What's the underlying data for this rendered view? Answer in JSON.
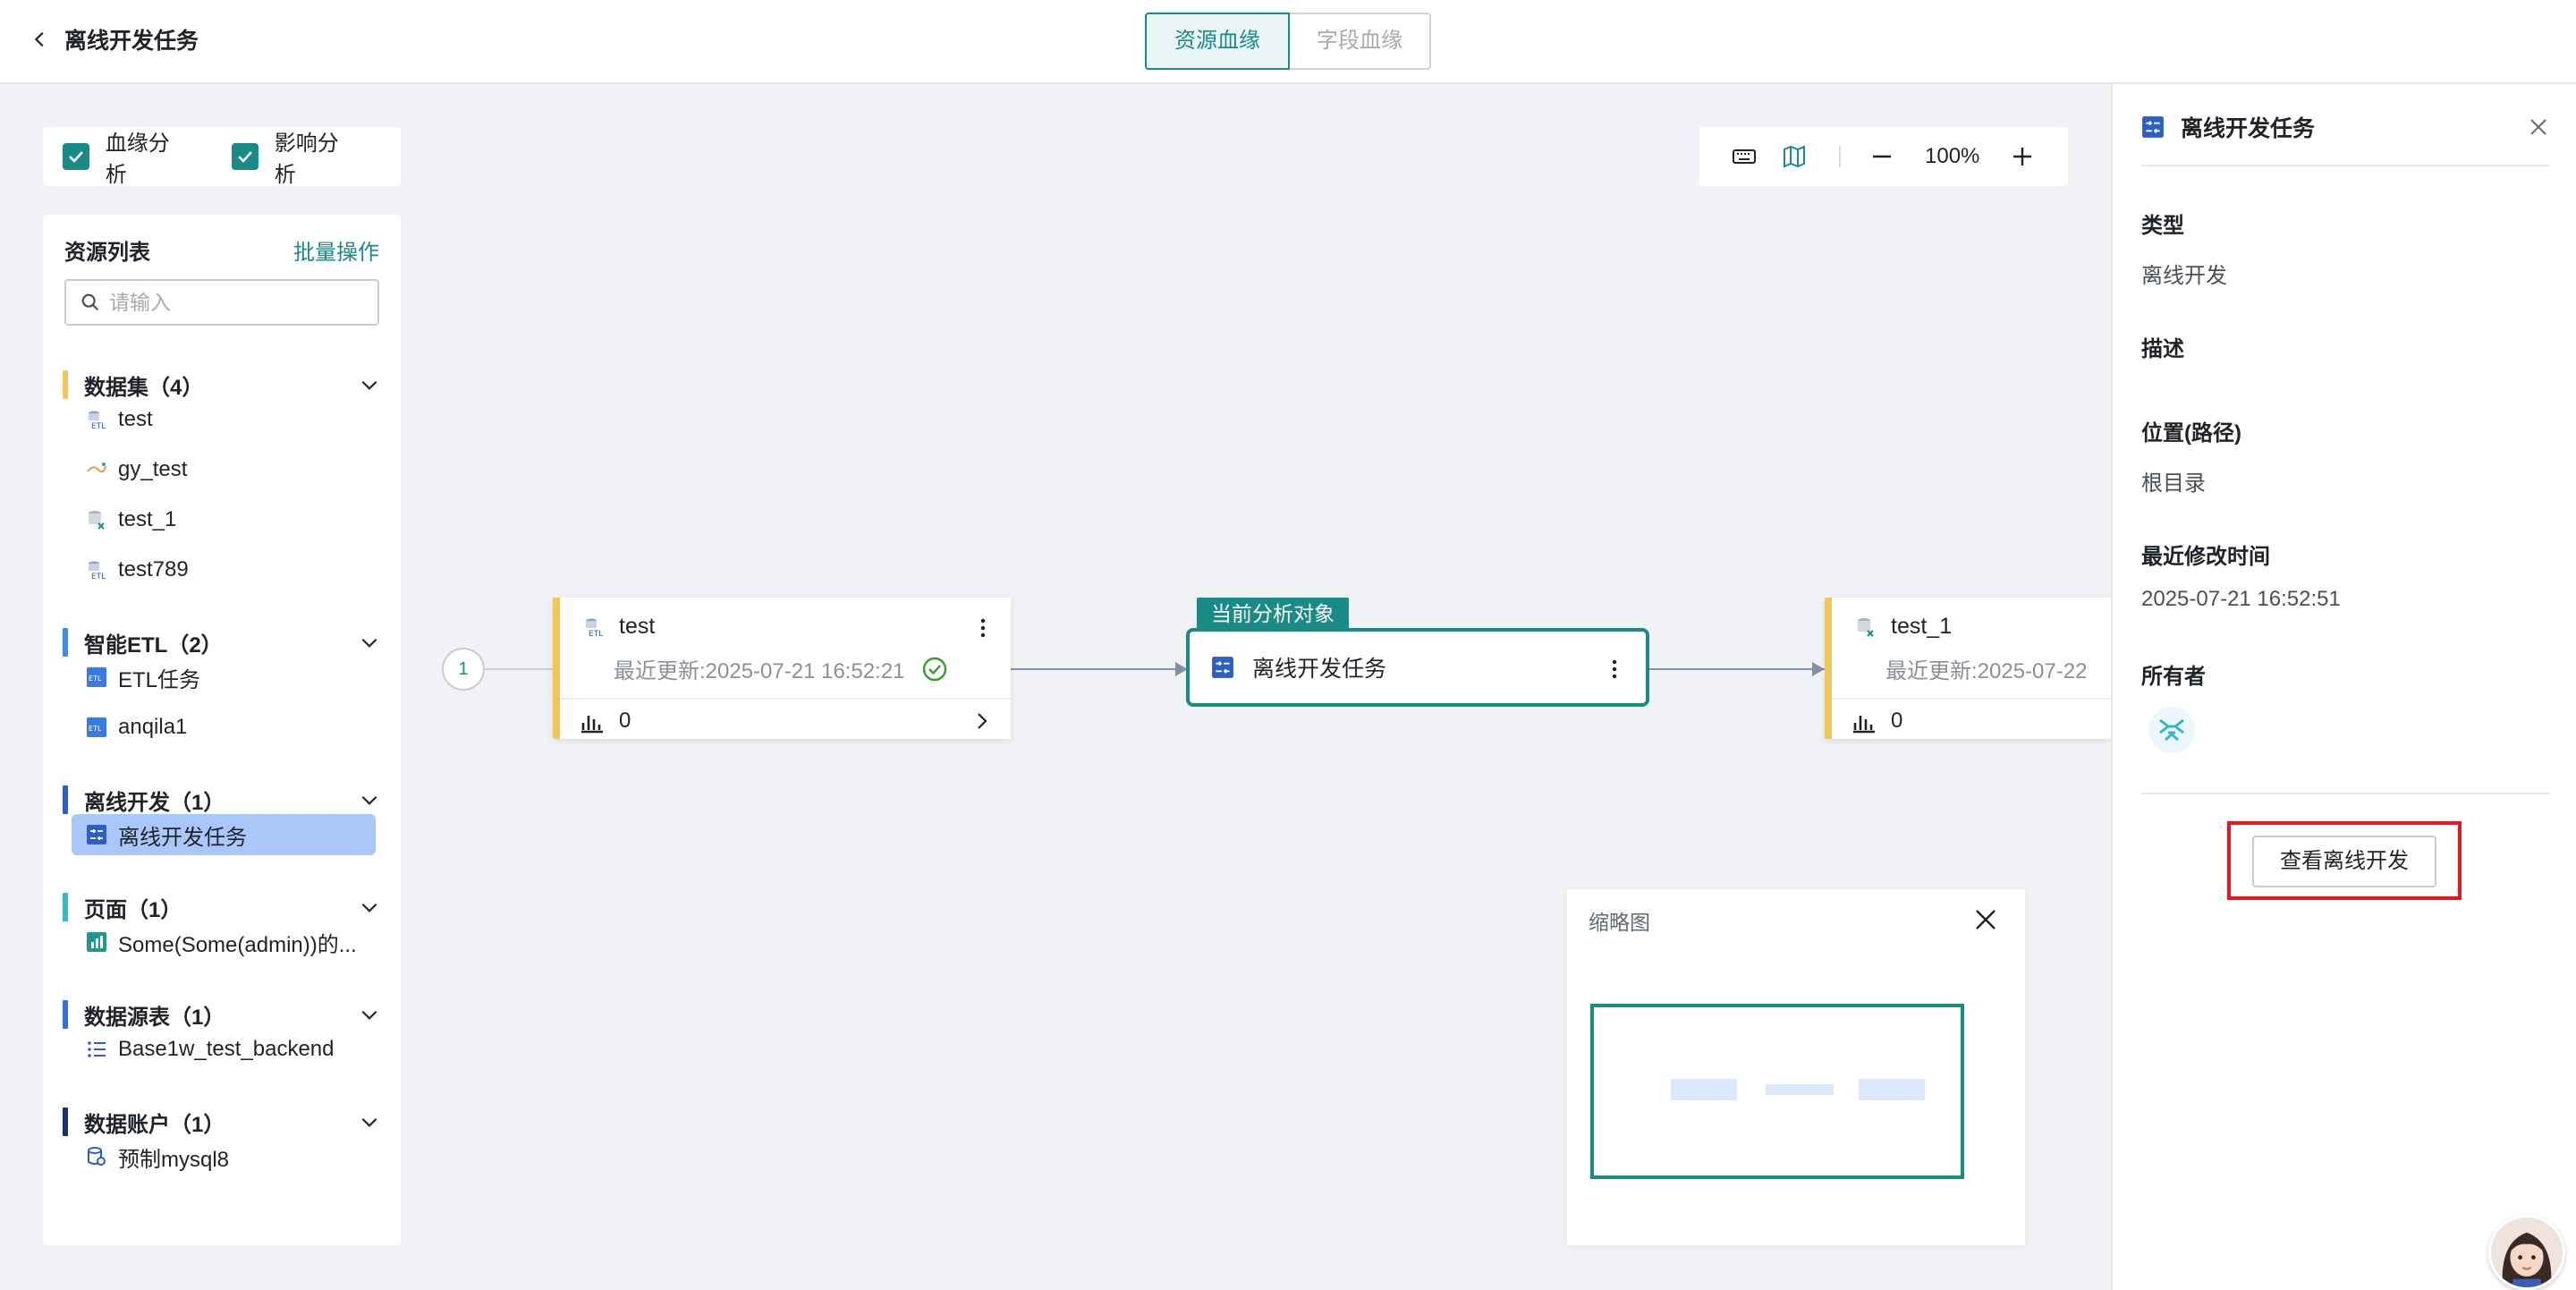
{
  "header": {
    "title": "离线开发任务",
    "tabs": [
      {
        "label": "资源血缘",
        "active": true
      },
      {
        "label": "字段血缘",
        "active": false
      }
    ]
  },
  "analysis": {
    "lineage_label": "血缘分析",
    "lineage_checked": true,
    "impact_label": "影响分析",
    "impact_checked": true
  },
  "resources": {
    "title": "资源列表",
    "batch_label": "批量操作",
    "search_placeholder": "请输入",
    "groups": [
      {
        "label": "数据集（4）",
        "color": "#f0c75a",
        "items": [
          "test",
          "gy_test",
          "test_1",
          "test789"
        ]
      },
      {
        "label": "智能ETL（2）",
        "color": "#3b8ee8",
        "items": [
          "ETL任务",
          "anqila1"
        ]
      },
      {
        "label": "离线开发（1）",
        "color": "#2f5fc4",
        "items": [
          "离线开发任务"
        ]
      },
      {
        "label": "页面（1）",
        "color": "#35b7c5",
        "items": [
          "Some(Some(admin))的..."
        ]
      },
      {
        "label": "数据源表（1）",
        "color": "#3570d8",
        "items": [
          "Base1w_test_backend"
        ]
      },
      {
        "label": "数据账户（1）",
        "color": "#1c2f6e",
        "items": [
          "预制mysql8"
        ]
      }
    ],
    "selected_item": "离线开发任务"
  },
  "toolbar": {
    "zoom": "100%",
    "icons": [
      "keyboard-icon",
      "map-icon",
      "zoom-out-icon",
      "zoom-in-icon"
    ]
  },
  "graph": {
    "depth_badge": "1",
    "upstream": {
      "name": "test",
      "updated": "最近更新:2025-07-21 16:52:21",
      "count": "0",
      "status": "success"
    },
    "current_tag": "当前分析对象",
    "current": {
      "name": "离线开发任务"
    },
    "downstream": {
      "name": "test_1",
      "updated": "最近更新:2025-07-22",
      "count": "0"
    }
  },
  "minimap": {
    "title": "缩略图"
  },
  "detail": {
    "title": "离线开发任务",
    "type_label": "类型",
    "type_value": "离线开发",
    "desc_label": "描述",
    "path_label": "位置(路径)",
    "path_value": "根目录",
    "modified_label": "最近修改时间",
    "modified_value": "2025-07-21 16:52:51",
    "owner_label": "所有者",
    "view_button": "查看离线开发"
  },
  "colors": {
    "accent": "#1a8a86",
    "selected_bg": "#a9c8f9",
    "highlight_border": "#e8171f",
    "dataset_bar": "#f0c75a"
  }
}
